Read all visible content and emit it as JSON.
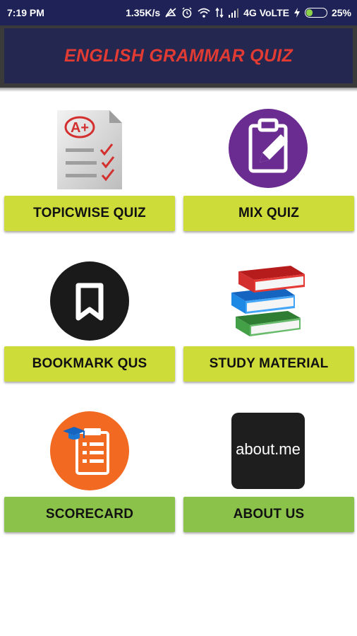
{
  "status_bar": {
    "time": "7:19 PM",
    "speed": "1.35K/s",
    "network": "4G VoLTE",
    "battery": "25%",
    "battery_level": 0.25
  },
  "header": {
    "title": "ENGLISH GRAMMAR QUIZ"
  },
  "colors": {
    "header_bg": "#24274f",
    "title": "#e23b33",
    "button_yellow": "#cddc39",
    "button_green": "#8bc34a"
  },
  "tiles": [
    {
      "label": "TOPICWISE QUIZ",
      "icon": "graded-test-icon"
    },
    {
      "label": "MIX QUIZ",
      "icon": "clipboard-pencil-icon"
    },
    {
      "label": "BOOKMARK QUS",
      "icon": "bookmark-icon"
    },
    {
      "label": "STUDY MATERIAL",
      "icon": "books-stack-icon"
    },
    {
      "label": "SCORECARD",
      "icon": "scorecard-icon"
    },
    {
      "label": "ABOUT US",
      "icon": "about-me-icon",
      "icon_text": "about.me"
    }
  ],
  "icons": {
    "grade_text": "A+"
  }
}
